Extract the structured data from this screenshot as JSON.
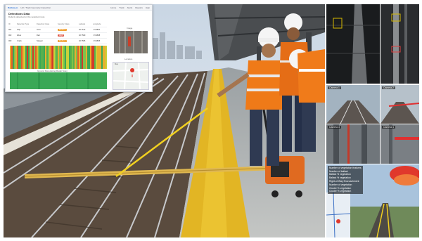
{
  "dashboard": {
    "app_name": "Railway.io",
    "path": "HU / Track Geometry Inspection",
    "nav": [
      "Home",
      "Track",
      "Alerts",
      "Reports",
      "Help"
    ],
    "title": "Detections Data",
    "subtitle": "Defects detected on the selected route",
    "table_headers": [
      "ID",
      "Detection Type",
      "Detection Class",
      "Severity Class",
      "Latitude",
      "Longitude"
    ],
    "rows": [
      {
        "id": "001",
        "type": "Gap",
        "cls": "Joint",
        "sev": "Medium",
        "lat": "40.7512",
        "lon": "-73.9841"
      },
      {
        "id": "002",
        "type": "Wear",
        "cls": "Rail",
        "sev": "High",
        "lat": "40.7509",
        "lon": "-73.9838"
      },
      {
        "id": "003",
        "type": "Crack",
        "cls": "Sleeper",
        "sev": "Medium",
        "lat": "40.7505",
        "lon": "-73.9835"
      }
    ],
    "image_label": "Image",
    "location_label": "Location",
    "map_label": "Map",
    "heatmap_title": "Ground Penetrating Radar Scan",
    "colors": {
      "medium": "#f0a030",
      "high": "#e05a4a",
      "accent": "#2a6fd6"
    }
  },
  "camera_panels": [
    {
      "label": "Camera 1"
    },
    {
      "label": "Camera 2"
    },
    {
      "label": "Camera 3"
    },
    {
      "label": "Camera 4"
    }
  ],
  "overlay_text": [
    "Number of vegetation features",
    "Number of ballast",
    "Ballast % vegetation",
    "Ballast % vegetation",
    "Right-of-Way Encroachment",
    "Number of vegetation",
    "Cluster % vegetation",
    "Cluster % vegetation"
  ]
}
